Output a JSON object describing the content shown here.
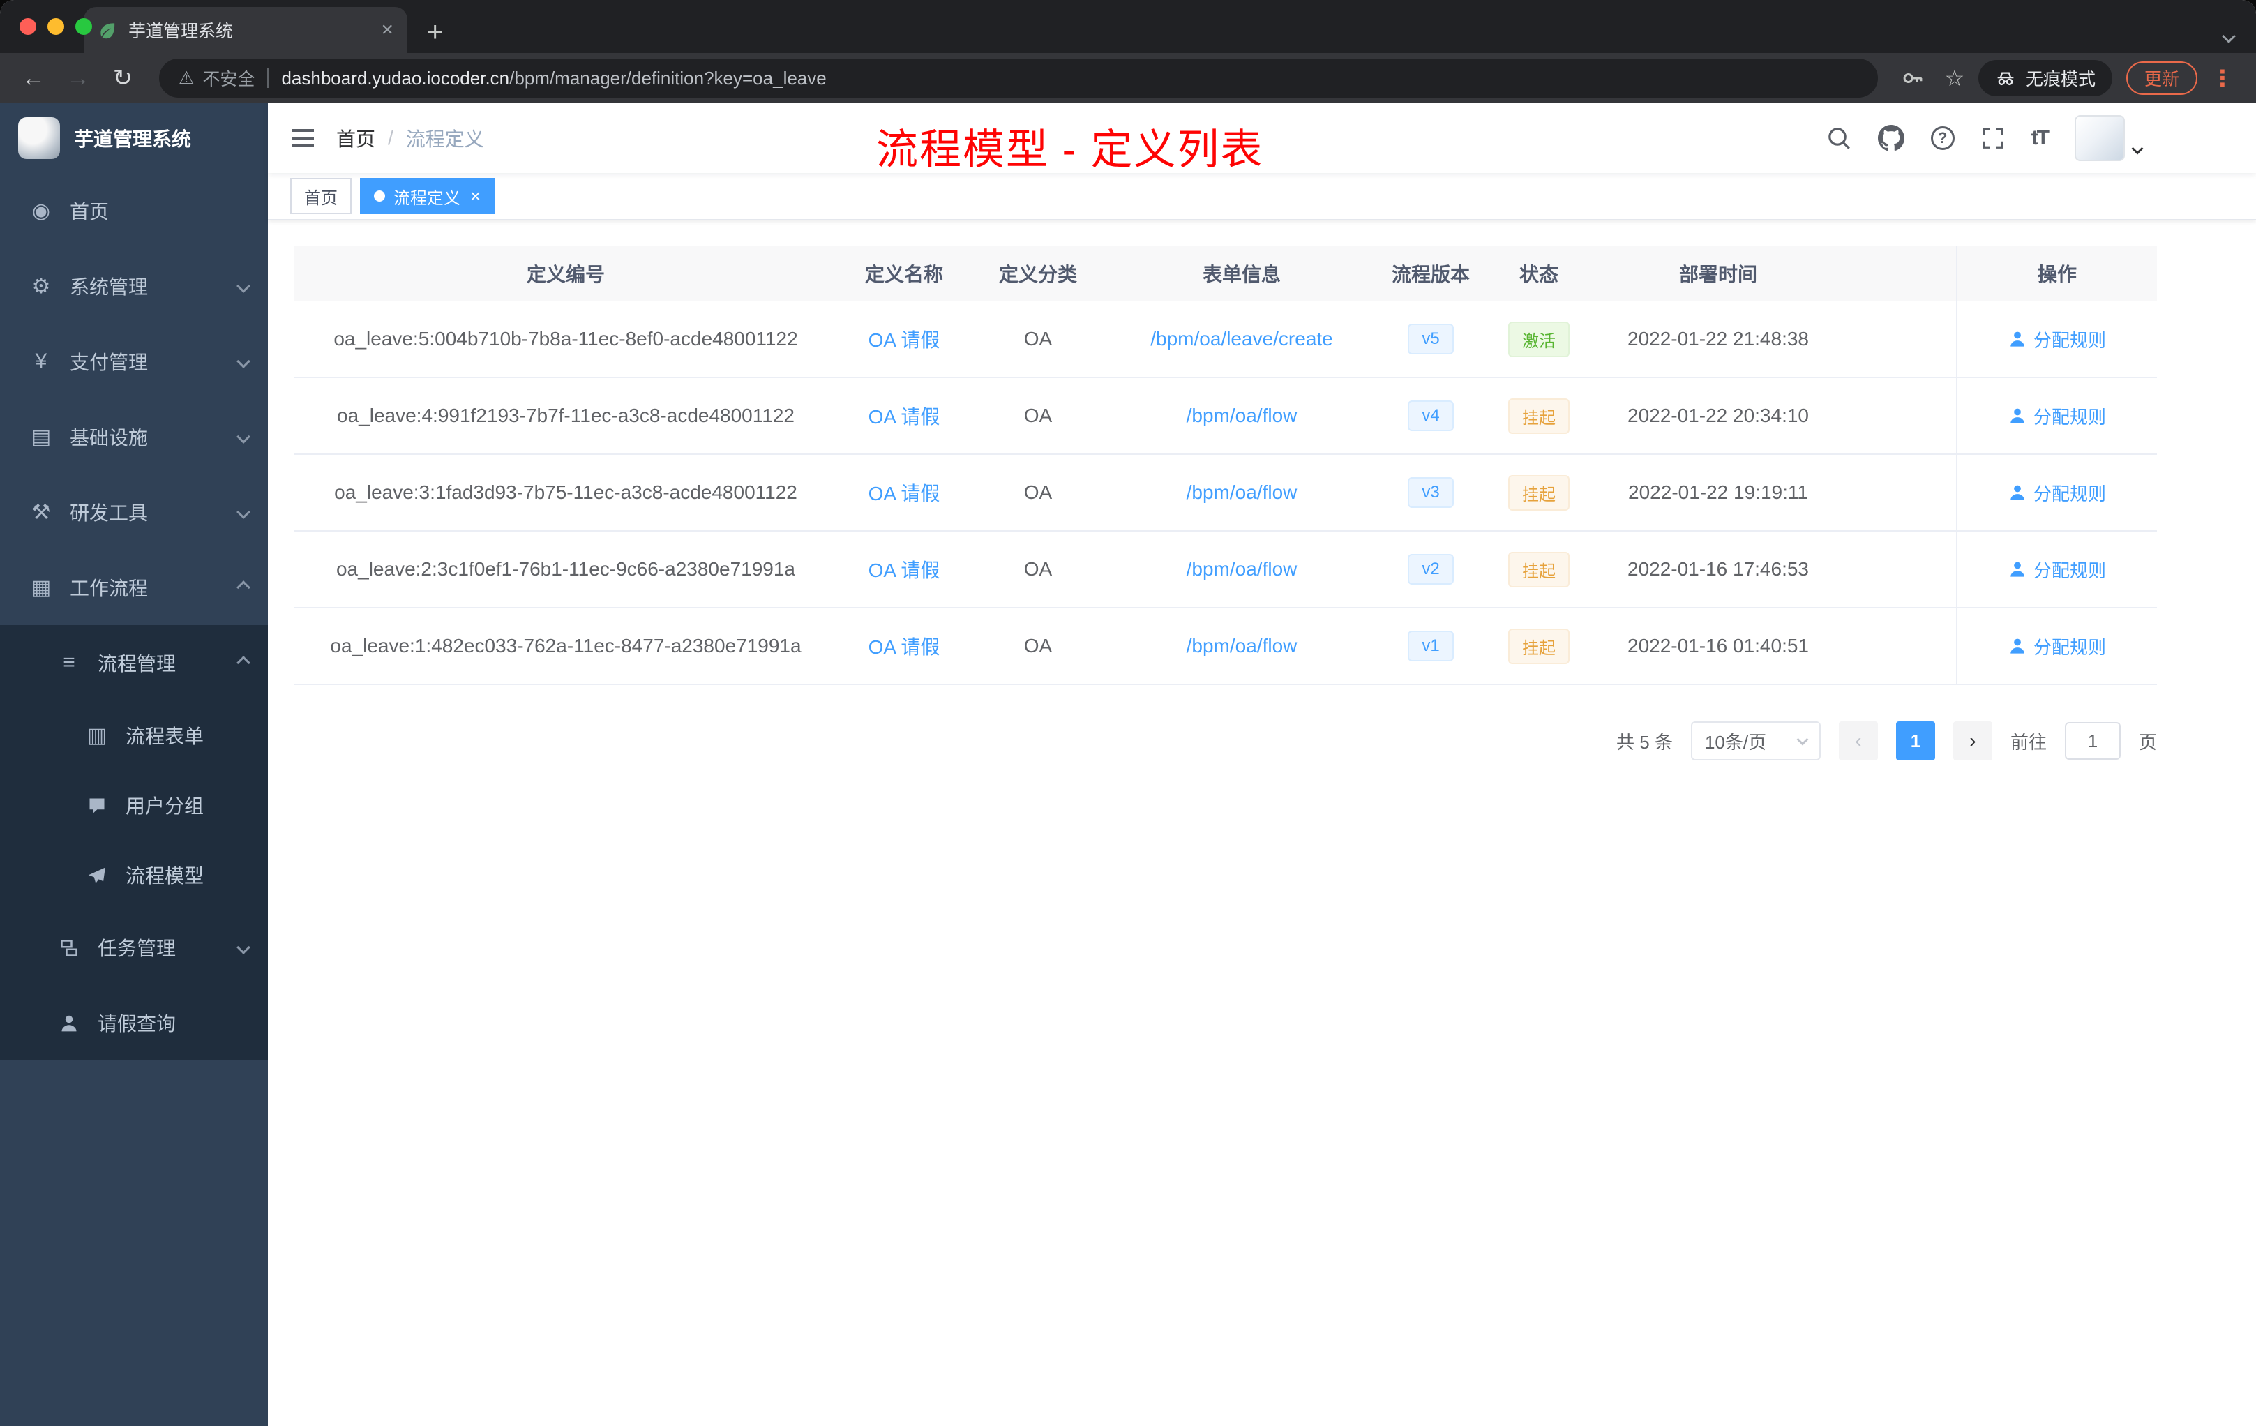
{
  "browser": {
    "tab_title": "芋道管理系统",
    "close_glyph": "×",
    "plus_glyph": "+",
    "back_glyph": "←",
    "forward_glyph": "→",
    "reload_glyph": "↻",
    "warning_glyph": "⚠",
    "star_glyph": "☆",
    "dots_glyph": "⋮",
    "security_label": "不安全",
    "url_domain": "dashboard.yudao.iocoder.cn",
    "url_path": "/bpm/manager/definition?key=oa_leave",
    "incognito_label": "无痕模式",
    "update_label": "更新"
  },
  "sidebar": {
    "logo_title": "芋道管理系统",
    "items": [
      {
        "label": "首页",
        "icon": "dashboard",
        "glyph": "◉",
        "level": 1
      },
      {
        "label": "系统管理",
        "icon": "gear",
        "glyph": "⚙",
        "level": 1,
        "chevron": "down"
      },
      {
        "label": "支付管理",
        "icon": "yen",
        "glyph": "¥",
        "level": 1,
        "chevron": "down"
      },
      {
        "label": "基础设施",
        "icon": "infrastructure",
        "glyph": "▤",
        "level": 1,
        "chevron": "down"
      },
      {
        "label": "研发工具",
        "icon": "dev-tools",
        "glyph": "⚒",
        "level": 1,
        "chevron": "down"
      },
      {
        "label": "工作流程",
        "icon": "workflow",
        "glyph": "▦",
        "level": 1,
        "chevron": "up"
      },
      {
        "label": "流程管理",
        "icon": "process-list",
        "glyph": "≡",
        "level": 2,
        "chevron": "up"
      },
      {
        "label": "流程表单",
        "icon": "form-document",
        "glyph": "▥",
        "level": 3
      },
      {
        "label": "用户分组",
        "icon": "user-group",
        "level": 3
      },
      {
        "label": "流程模型",
        "icon": "paper-plane",
        "level": 3
      },
      {
        "label": "任务管理",
        "icon": "task-stack",
        "level": 2,
        "chevron": "down"
      },
      {
        "label": "请假查询",
        "icon": "person",
        "level": 2
      }
    ]
  },
  "navbar": {
    "breadcrumb_home": "首页",
    "breadcrumb_sep": "/",
    "breadcrumb_current": "流程定义",
    "help_glyph": "?",
    "font_size_glyph": "tT"
  },
  "annotation": {
    "text": "流程模型 - 定义列表",
    "color": "#fe0404"
  },
  "tags": {
    "home": "首页",
    "active": "流程定义",
    "close_glyph": "×"
  },
  "table": {
    "columns": [
      "定义编号",
      "定义名称",
      "定义分类",
      "表单信息",
      "流程版本",
      "状态",
      "部署时间",
      "操作"
    ],
    "rows": [
      {
        "id": "oa_leave:5:004b710b-7b8a-11ec-8ef0-acde48001122",
        "name": "OA 请假",
        "category": "OA",
        "form": "/bpm/oa/leave/create",
        "version": "v5",
        "status": "激活",
        "status_type": "success",
        "deploy_time": "2022-01-22 21:48:38",
        "action": "分配规则"
      },
      {
        "id": "oa_leave:4:991f2193-7b7f-11ec-a3c8-acde48001122",
        "name": "OA 请假",
        "category": "OA",
        "form": "/bpm/oa/flow",
        "version": "v4",
        "status": "挂起",
        "status_type": "warning",
        "deploy_time": "2022-01-22 20:34:10",
        "action": "分配规则"
      },
      {
        "id": "oa_leave:3:1fad3d93-7b75-11ec-a3c8-acde48001122",
        "name": "OA 请假",
        "category": "OA",
        "form": "/bpm/oa/flow",
        "version": "v3",
        "status": "挂起",
        "status_type": "warning",
        "deploy_time": "2022-01-22 19:19:11",
        "action": "分配规则"
      },
      {
        "id": "oa_leave:2:3c1f0ef1-76b1-11ec-9c66-a2380e71991a",
        "name": "OA 请假",
        "category": "OA",
        "form": "/bpm/oa/flow",
        "version": "v2",
        "status": "挂起",
        "status_type": "warning",
        "deploy_time": "2022-01-16 17:46:53",
        "action": "分配规则"
      },
      {
        "id": "oa_leave:1:482ec033-762a-11ec-8477-a2380e71991a",
        "name": "OA 请假",
        "category": "OA",
        "form": "/bpm/oa/flow",
        "version": "v1",
        "status": "挂起",
        "status_type": "warning",
        "deploy_time": "2022-01-16 01:40:51",
        "action": "分配规则"
      }
    ]
  },
  "pagination": {
    "total": "共 5 条",
    "page_size": "10条/页",
    "prev_glyph": "‹",
    "current_page": "1",
    "next_glyph": "›",
    "goto_label": "前往",
    "goto_value": "1",
    "goto_unit": "页"
  },
  "colors": {
    "accent": "#409eff",
    "success": "#67c23a",
    "warning": "#e6a23c",
    "sidebar_bg": "#304156",
    "sidebar_submenu_bg": "#1f2d3d",
    "annotation_red": "#fe0404",
    "chrome_frame": "#202124",
    "chrome_toolbar": "#35363a",
    "update_orange": "#e9694a",
    "traffic_red": "#ff5f57",
    "traffic_yellow": "#febc2e",
    "traffic_green": "#28c840"
  }
}
